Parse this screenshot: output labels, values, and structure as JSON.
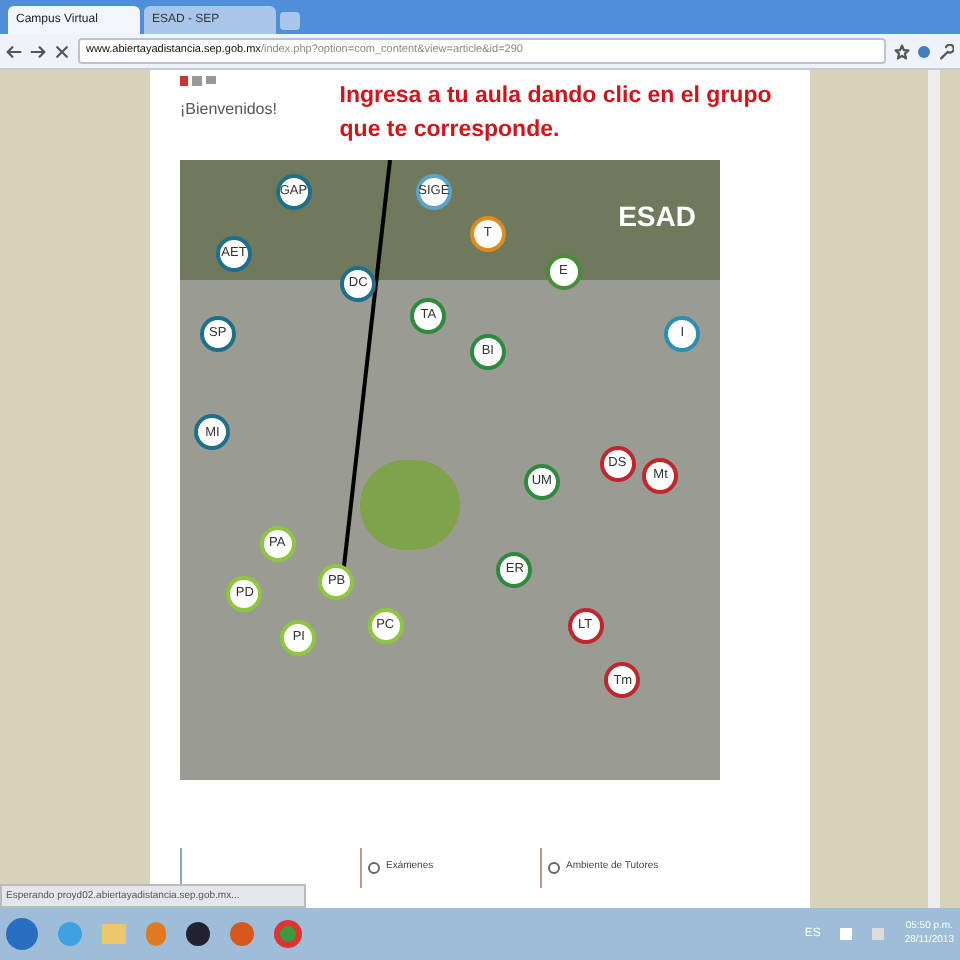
{
  "browser": {
    "tabs": [
      {
        "label": "Campus Virtual",
        "selected": true
      },
      {
        "label": "ESAD - SEP",
        "selected": false
      }
    ],
    "url_host": "www.abiertayadistancia.sep.gob.mx",
    "url_path": "/index.php?option=com_content&view=article&id=290"
  },
  "page": {
    "welcome": "¡Bienvenidos!",
    "instruction": "Ingresa a tu aula dando clic en el grupo que te corresponde.",
    "logo": "ESAD",
    "pins": [
      {
        "label": "GAP",
        "color": "#1f6f8b"
      },
      {
        "label": "SIGE",
        "color": "#5ba3c9"
      },
      {
        "label": "AET",
        "color": "#1f6f8b"
      },
      {
        "label": "T",
        "color": "#e08a1e"
      },
      {
        "label": "E",
        "color": "#4a8c3a"
      },
      {
        "label": "DC",
        "color": "#1f6f8b"
      },
      {
        "label": "TA",
        "color": "#2e8b3e"
      },
      {
        "label": "SP",
        "color": "#1f6f8b"
      },
      {
        "label": "I",
        "color": "#2a8fb0"
      },
      {
        "label": "BI",
        "color": "#2e8b3e"
      },
      {
        "label": "MI",
        "color": "#1f6f8b"
      },
      {
        "label": "DS",
        "color": "#c0272d"
      },
      {
        "label": "Mt",
        "color": "#c0272d"
      },
      {
        "label": "UM",
        "color": "#2e8b3e"
      },
      {
        "label": "PA",
        "color": "#8dc63f"
      },
      {
        "label": "ER",
        "color": "#2e8b3e"
      },
      {
        "label": "PB",
        "color": "#8dc63f"
      },
      {
        "label": "PD",
        "color": "#8dc63f"
      },
      {
        "label": "PC",
        "color": "#8dc63f"
      },
      {
        "label": "LT",
        "color": "#c0272d"
      },
      {
        "label": "PI",
        "color": "#8dc63f"
      },
      {
        "label": "Tm",
        "color": "#c0272d"
      }
    ],
    "bottom_tabs": [
      "Exámenes",
      "Ambiente de Tutores"
    ]
  },
  "status": "Esperando proyd02.abiertayadistancia.sep.gob.mx...",
  "taskbar": {
    "language": "ES",
    "time": "05:50 p.m.",
    "date": "28/11/2013"
  }
}
